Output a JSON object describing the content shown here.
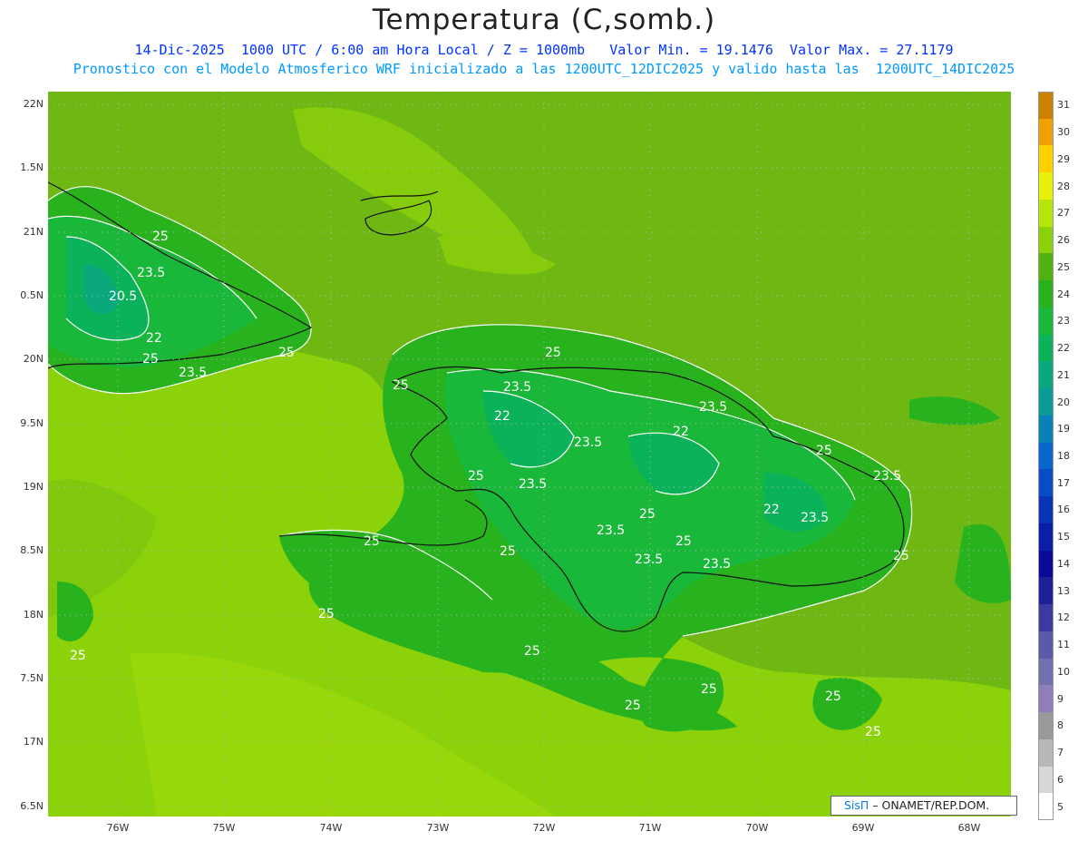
{
  "header": {
    "title": "Temperatura (C,somb.)",
    "subtitle1": "14-Dic-2025  1000 UTC / 6:00 am Hora Local / Z = 1000mb   Valor Min. = 19.1476  Valor Max. = 27.1179",
    "subtitle2": "Pronostico con el Modelo Atmosferico WRF inicializado a las 1200UTC_12DIC2025 y valido hasta las  1200UTC_14DIC2025"
  },
  "axes": {
    "lat_labels": [
      "22N",
      "1.5N",
      "21N",
      "0.5N",
      "20N",
      "9.5N",
      "19N",
      "8.5N",
      "18N",
      "7.5N",
      "17N",
      "6.5N"
    ],
    "lon_labels": [
      "76W",
      "75W",
      "74W",
      "73W",
      "72W",
      "71W",
      "70W",
      "69W",
      "68W"
    ]
  },
  "colorbar": {
    "levels": [
      "5",
      "6",
      "7",
      "8",
      "9",
      "10",
      "11",
      "12",
      "13",
      "14",
      "15",
      "16",
      "17",
      "18",
      "19",
      "20",
      "21",
      "22",
      "23",
      "24",
      "25",
      "26",
      "27",
      "28",
      "29",
      "30",
      "31"
    ],
    "colors": [
      "#ffffff",
      "#d8d8d8",
      "#b8b8b8",
      "#9a9a9a",
      "#8f7fb8",
      "#7370b0",
      "#5a5aa8",
      "#3a3aa0",
      "#1f1f9a",
      "#0a0a96",
      "#0a1ea6",
      "#0a34b8",
      "#0a4cc8",
      "#0a66cc",
      "#0a80b8",
      "#0a9a9a",
      "#0aa87a",
      "#0ab25a",
      "#1ab83a",
      "#28b21e",
      "#52b010",
      "#8cd20a",
      "#b4e60a",
      "#e6f00a",
      "#ffd000",
      "#f0a000",
      "#cc8000"
    ]
  },
  "contour_labels": [
    "25",
    "23.5",
    "20.5",
    "22",
    "23.5",
    "25",
    "25",
    "23.5",
    "25",
    "23.5",
    "22",
    "25",
    "25",
    "23.5",
    "25",
    "23.5",
    "22",
    "25",
    "23.5",
    "22",
    "23.5",
    "25",
    "23.5",
    "23.5",
    "25",
    "23.5",
    "25",
    "25",
    "25",
    "25",
    "25",
    "25",
    "25",
    "25",
    "25"
  ],
  "logo": {
    "sis": "SisΠ",
    "org": "– ONAMET/REP.DOM."
  }
}
